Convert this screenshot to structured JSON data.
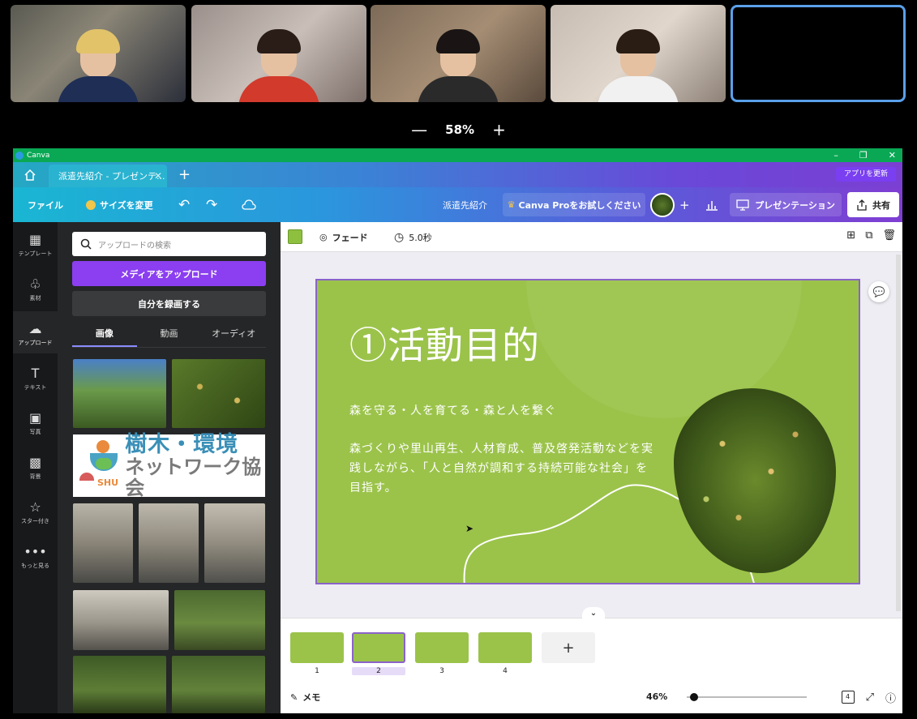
{
  "meeting": {
    "zoom_minus": "—",
    "zoom_level": "58%",
    "zoom_plus": "+",
    "participants": [
      "participant-1",
      "participant-2",
      "participant-3",
      "participant-4",
      "participant-5-selected"
    ]
  },
  "window": {
    "app_name": "Canva",
    "minimize": "–",
    "restore": "❐",
    "close": "✕"
  },
  "tabs": {
    "home_icon": "home-icon",
    "active_tab": "派遣先紹介 - プレゼンテ...",
    "new_tab": "+",
    "update_app": "アプリを更新"
  },
  "toolbar": {
    "file": "ファイル",
    "resize": "サイズを変更",
    "undo": "↶",
    "redo": "↷",
    "doc_title": "派遣先紹介",
    "promo": "Canva Proをお試しください",
    "plus": "+",
    "present": "プレゼンテーション",
    "share": "共有",
    "accent": "#8b3ff0"
  },
  "rail": {
    "items": [
      {
        "label": "テンプレート",
        "icon": "layout-icon"
      },
      {
        "label": "素材",
        "icon": "elements-icon"
      },
      {
        "label": "アップロード",
        "icon": "upload-icon"
      },
      {
        "label": "テキスト",
        "icon": "text-icon"
      },
      {
        "label": "写真",
        "icon": "photo-icon"
      },
      {
        "label": "背景",
        "icon": "background-icon"
      },
      {
        "label": "スター付き",
        "icon": "star-icon"
      },
      {
        "label": "もっと見る",
        "icon": "more-icon"
      }
    ]
  },
  "panel": {
    "search_placeholder": "アップロードの検索",
    "upload_button": "メディアをアップロード",
    "record_button": "自分を録画する",
    "tabs": [
      "画像",
      "動画",
      "オーディオ"
    ],
    "logo_line1": "樹木・環境",
    "logo_line2": "ネットワーク協会",
    "logo_mark": "SHU"
  },
  "editor": {
    "swatch_color": "#8fbf3f",
    "transition": "フェード",
    "duration": "5.0秒"
  },
  "slide": {
    "title": "①活動目的",
    "subtitle": "森を守る・人を育てる・森と人を繋ぐ",
    "body": "森づくりや里山再生、人材育成、普及啓発活動などを実践しながら、「人と自然が調和する持続可能な社会」を目指す。",
    "bg_color": "#9bc34a"
  },
  "pages": {
    "numbers": [
      "1",
      "2",
      "3",
      "4"
    ],
    "active_index": 2,
    "add": "+"
  },
  "footer": {
    "memo": "メモ",
    "zoom": "46%",
    "page_count": "4",
    "zoom_fraction": 0.05
  }
}
